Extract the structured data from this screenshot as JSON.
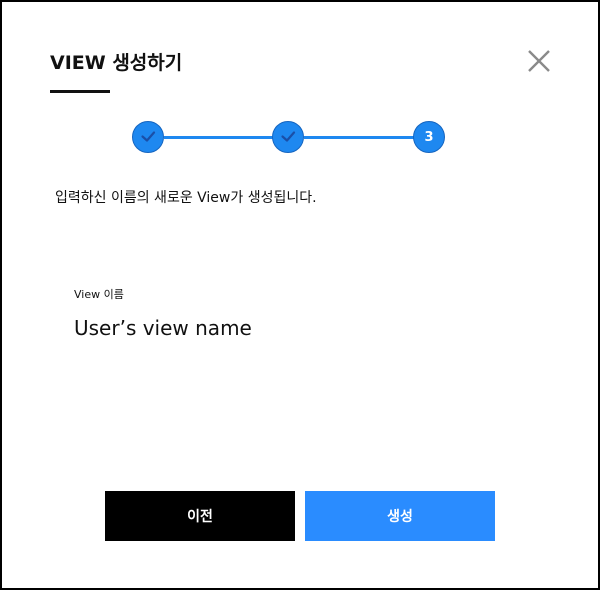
{
  "dialog": {
    "title": "VIEW 생성하기",
    "close_icon": "close-icon"
  },
  "stepper": {
    "steps": [
      {
        "state": "done",
        "icon": "check-icon"
      },
      {
        "state": "done",
        "icon": "check-icon"
      },
      {
        "state": "current",
        "label": "3"
      }
    ],
    "accent_color": "#1e88f0"
  },
  "description": "입력하신 이름의 새로운 View가 생성됩니다.",
  "field": {
    "label": "View 이름",
    "value": "User’s view name"
  },
  "buttons": {
    "prev_label": "이전",
    "create_label": "생성",
    "prev_color": "#000000",
    "create_color": "#2a8cff"
  }
}
